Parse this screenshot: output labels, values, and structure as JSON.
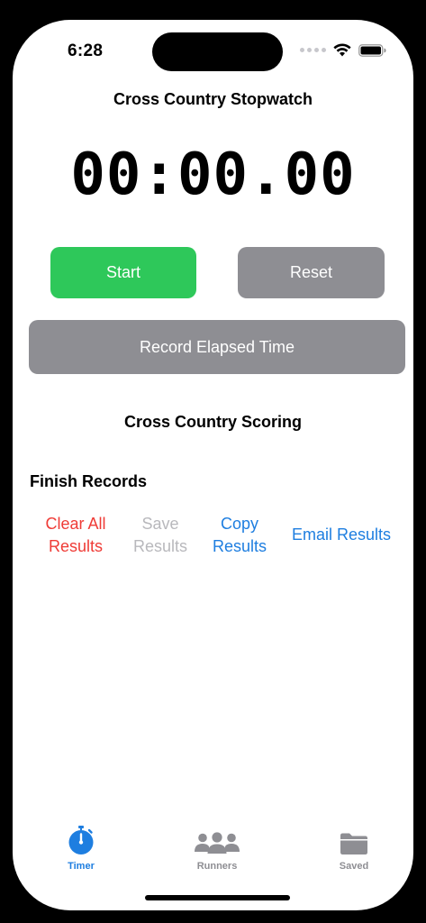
{
  "status_bar": {
    "time": "6:28",
    "signal_icon": "signal-dots-icon",
    "wifi_icon": "wifi-icon",
    "battery_icon": "battery-icon"
  },
  "header": {
    "title": "Cross Country Stopwatch"
  },
  "timer": {
    "display": "00:00.00"
  },
  "controls": {
    "start_label": "Start",
    "reset_label": "Reset",
    "record_label": "Record Elapsed Time"
  },
  "scoring": {
    "title": "Cross Country Scoring"
  },
  "finish_records": {
    "title": "Finish Records",
    "clear_line1": "Clear All",
    "clear_line2": "Results",
    "save_line1": "Save",
    "save_line2": "Results",
    "copy_line1": "Copy",
    "copy_line2": "Results",
    "email_label": "Email Results"
  },
  "tab_bar": {
    "tabs": [
      {
        "label": "Timer",
        "icon": "stopwatch-icon",
        "selected": true
      },
      {
        "label": "Runners",
        "icon": "people-icon",
        "selected": false
      },
      {
        "label": "Saved",
        "icon": "folder-icon",
        "selected": false
      }
    ]
  },
  "colors": {
    "start_green": "#2ec85a",
    "neutral_gray": "#8e8e93",
    "destructive_red": "#ef3b36",
    "link_blue": "#1e7ee0",
    "disabled_gray": "#b8b8bc"
  }
}
